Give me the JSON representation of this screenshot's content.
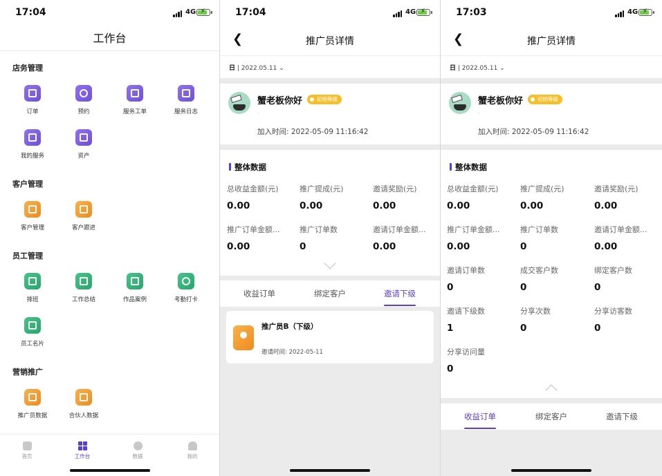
{
  "workbench": {
    "status_time": "17:04",
    "network": "4G",
    "title": "工作台",
    "sections": [
      {
        "title": "店务管理",
        "items": [
          {
            "label": "订单",
            "icon": "order-icon",
            "color": "purple"
          },
          {
            "label": "预约",
            "icon": "clock-icon",
            "color": "purple"
          },
          {
            "label": "服务工单",
            "icon": "work-order-icon",
            "color": "purple"
          },
          {
            "label": "服务日志",
            "icon": "log-icon",
            "color": "purple"
          },
          {
            "label": "我的服务",
            "icon": "my-service-icon",
            "color": "purple"
          },
          {
            "label": "资产",
            "icon": "wallet-icon",
            "color": "purple"
          }
        ]
      },
      {
        "title": "客户管理",
        "items": [
          {
            "label": "客户管理",
            "icon": "diamond-icon",
            "color": "orange"
          },
          {
            "label": "客户跟进",
            "icon": "follow-up-icon",
            "color": "orange"
          }
        ]
      },
      {
        "title": "员工管理",
        "items": [
          {
            "label": "排班",
            "icon": "calendar-icon",
            "color": "green"
          },
          {
            "label": "工作总结",
            "icon": "edit-icon",
            "color": "green"
          },
          {
            "label": "作品案例",
            "icon": "book-icon",
            "color": "green"
          },
          {
            "label": "考勤打卡",
            "icon": "clock-in-icon",
            "color": "green"
          },
          {
            "label": "员工名片",
            "icon": "id-card-icon",
            "color": "green"
          }
        ]
      },
      {
        "title": "营销推广",
        "items": [
          {
            "label": "推广员数据",
            "icon": "promoter-icon",
            "color": "orange"
          },
          {
            "label": "合伙人数据",
            "icon": "partner-chart-icon",
            "color": "orange"
          }
        ]
      }
    ],
    "tabbar": [
      {
        "label": "首页",
        "icon": "home-icon"
      },
      {
        "label": "工作台",
        "icon": "grid-icon"
      },
      {
        "label": "数据",
        "icon": "pie-chart-icon"
      },
      {
        "label": "我的",
        "icon": "person-icon"
      }
    ],
    "active_tab": "工作台"
  },
  "detail_a": {
    "status_time": "17:04",
    "network": "4G",
    "nav_title": "推广员详情",
    "date_unit": "日",
    "date_value": "2022.05.11",
    "user_name": "蟹老板你好",
    "level_badge": "初始等级",
    "user_sub": ".",
    "joined_label": "加入时间: 2022-05-09 11:16:42",
    "overall_title": "整体数据",
    "stats": [
      {
        "label": "总收益金额(元)",
        "value": "0.00"
      },
      {
        "label": "推广提成(元)",
        "value": "0.00"
      },
      {
        "label": "邀请奖励(元)",
        "value": "0.00"
      },
      {
        "label": "推广订单金额...",
        "value": "0.00"
      },
      {
        "label": "推广订单数",
        "value": "0"
      },
      {
        "label": "邀请订单金额...",
        "value": "0.00"
      }
    ],
    "tabs": [
      "收益订单",
      "绑定客户",
      "邀请下级"
    ],
    "active_tab": "邀请下级",
    "invitee": {
      "name": "推广员B（下级）",
      "time": "邀请时间: 2022-05-11"
    }
  },
  "detail_b": {
    "status_time": "17:03",
    "network": "4G",
    "nav_title": "推广员详情",
    "date_unit": "日",
    "date_value": "2022.05.11",
    "user_name": "蟹老板你好",
    "level_badge": "初始等级",
    "user_sub": ".",
    "joined_label": "加入时间: 2022-05-09 11:16:42",
    "overall_title": "整体数据",
    "stats": [
      {
        "label": "总收益金额(元)",
        "value": "0.00"
      },
      {
        "label": "推广提成(元)",
        "value": "0.00"
      },
      {
        "label": "邀请奖励(元)",
        "value": "0.00"
      },
      {
        "label": "推广订单金额...",
        "value": "0.00"
      },
      {
        "label": "推广订单数",
        "value": "0"
      },
      {
        "label": "邀请订单金额...",
        "value": "0.00"
      },
      {
        "label": "邀请订单数",
        "value": "0"
      },
      {
        "label": "成交客户数",
        "value": "0"
      },
      {
        "label": "绑定客户数",
        "value": "0"
      },
      {
        "label": "邀请下级数",
        "value": "1"
      },
      {
        "label": "分享次数",
        "value": "0"
      },
      {
        "label": "分享访客数",
        "value": "0"
      },
      {
        "label": "分享访问量",
        "value": "0"
      }
    ],
    "tabs": [
      "收益订单",
      "绑定客户",
      "邀请下级"
    ],
    "active_tab": "收益订单"
  },
  "theme": {
    "accent": "#5b3fd1",
    "badge": "#f6bf2a"
  }
}
